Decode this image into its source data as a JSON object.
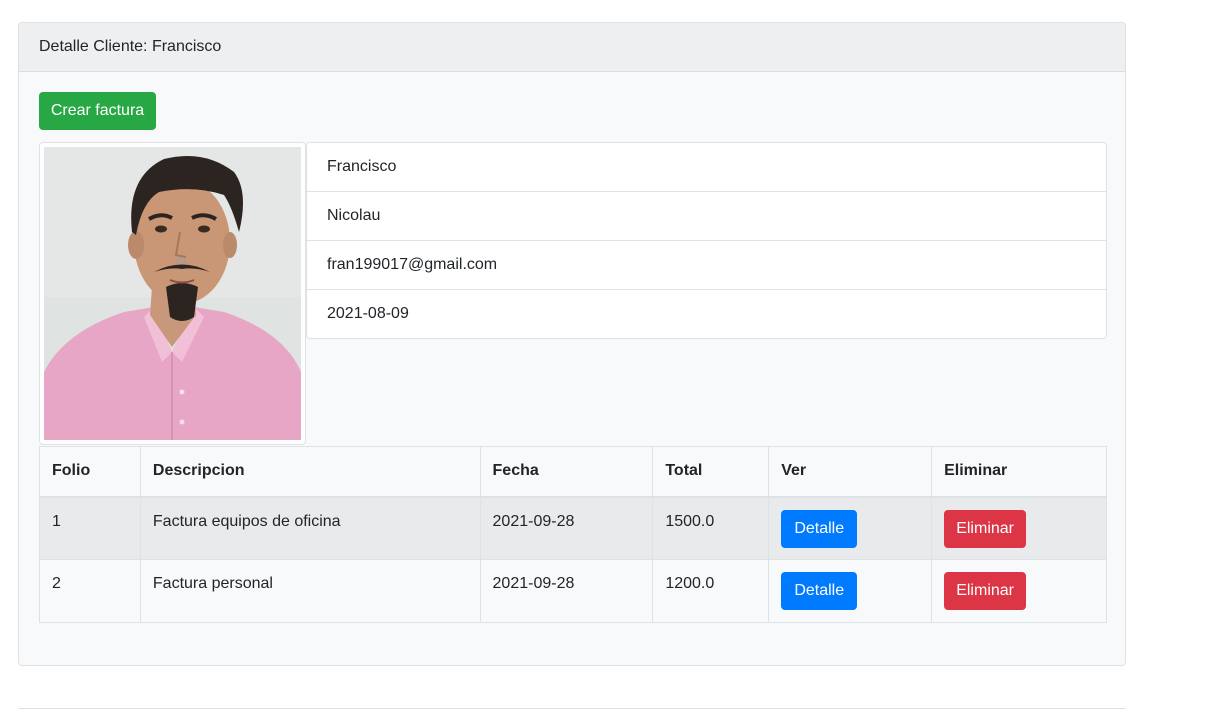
{
  "card": {
    "header": "Detalle Cliente: Francisco",
    "create_invoice_label": "Crear factura"
  },
  "client": {
    "photo_icon": "client-photo",
    "name": "Francisco",
    "surname": "Nicolau",
    "email": "fran199017@gmail.com",
    "date": "2021-08-09"
  },
  "invoices": {
    "headers": [
      "Folio",
      "Descripcion",
      "Fecha",
      "Total",
      "Ver",
      "Eliminar"
    ],
    "rows": [
      {
        "folio": "1",
        "descripcion": "Factura equipos de oficina",
        "fecha": "2021-09-28",
        "total": "1500.0",
        "ver": "Detalle",
        "eliminar": "Eliminar"
      },
      {
        "folio": "2",
        "descripcion": "Factura personal",
        "fecha": "2021-09-28",
        "total": "1200.0",
        "ver": "Detalle",
        "eliminar": "Eliminar"
      }
    ]
  },
  "colors": {
    "success": "#28a745",
    "primary": "#007bff",
    "danger": "#dc3545"
  }
}
